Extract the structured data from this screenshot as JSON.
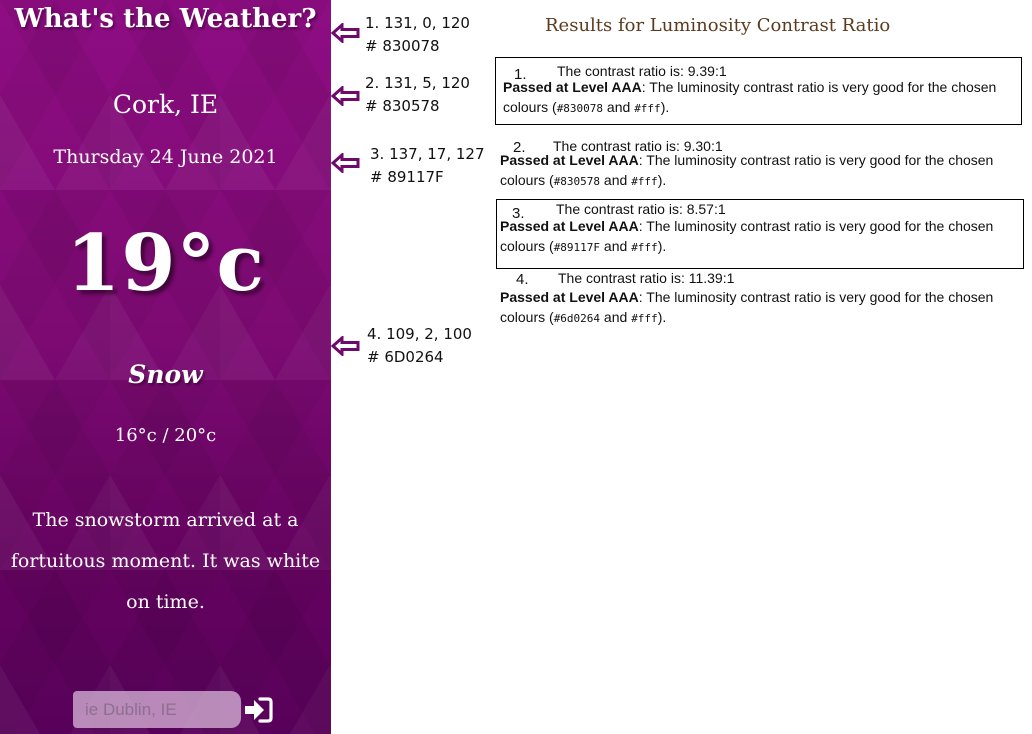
{
  "weather": {
    "app_title": "What's the Weather?",
    "city": "Cork, IE",
    "date": "Thursday 24 June 2021",
    "temperature": "19°c",
    "condition": "Snow",
    "range": "16°c / 20°c",
    "description": "The snowstorm arrived at a fortuitous moment. It was white on time.",
    "search_placeholder": "ie Dublin, IE",
    "submit_icon": "sign-in-arrow-icon"
  },
  "annotations": [
    {
      "line1": "1. 131, 0, 120",
      "line2": "# 830078"
    },
    {
      "line1": "2. 131, 5, 120",
      "line2": "# 830578"
    },
    {
      "line1": "3. 137, 17, 127",
      "line2": "# 89117F"
    },
    {
      "line1": "4. 109, 2, 100",
      "line2": "# 6D0264"
    }
  ],
  "results": {
    "title": "Results for Luminosity Contrast Ratio",
    "items": [
      {
        "num": "1.",
        "ratio": "The contrast ratio is: 9.39:1",
        "passed": "Passed at Level AAA",
        "message": ": The luminosity contrast ratio is very good for the chosen colours (",
        "color": "#830078",
        "and": " and ",
        "bg": "#fff",
        "end": ")."
      },
      {
        "num": "2.",
        "ratio": "The contrast ratio is: 9.30:1",
        "passed": "Passed at Level AAA",
        "message": ": The luminosity contrast ratio is very good for the chosen colours (",
        "color": "#830578",
        "and": " and ",
        "bg": "#fff",
        "end": ")."
      },
      {
        "num": "3.",
        "ratio": "The contrast ratio is: 8.57:1",
        "passed": "Passed at Level AAA",
        "message": ": The luminosity contrast ratio is very good for the chosen colours (",
        "color": "#89117F",
        "and": " and ",
        "bg": "#fff",
        "end": ")."
      },
      {
        "num": "4.",
        "ratio": "The contrast ratio is: 11.39:1",
        "passed": "Passed at Level AAA",
        "message": ": The luminosity contrast ratio is very good for the chosen colours (",
        "color": "#6d0264",
        "and": " and ",
        "bg": "#fff",
        "end": ")."
      }
    ]
  },
  "colors": {
    "arrow": "#6e0a6a",
    "panel_top": "#8e0d83",
    "panel_bottom": "#58015a"
  }
}
